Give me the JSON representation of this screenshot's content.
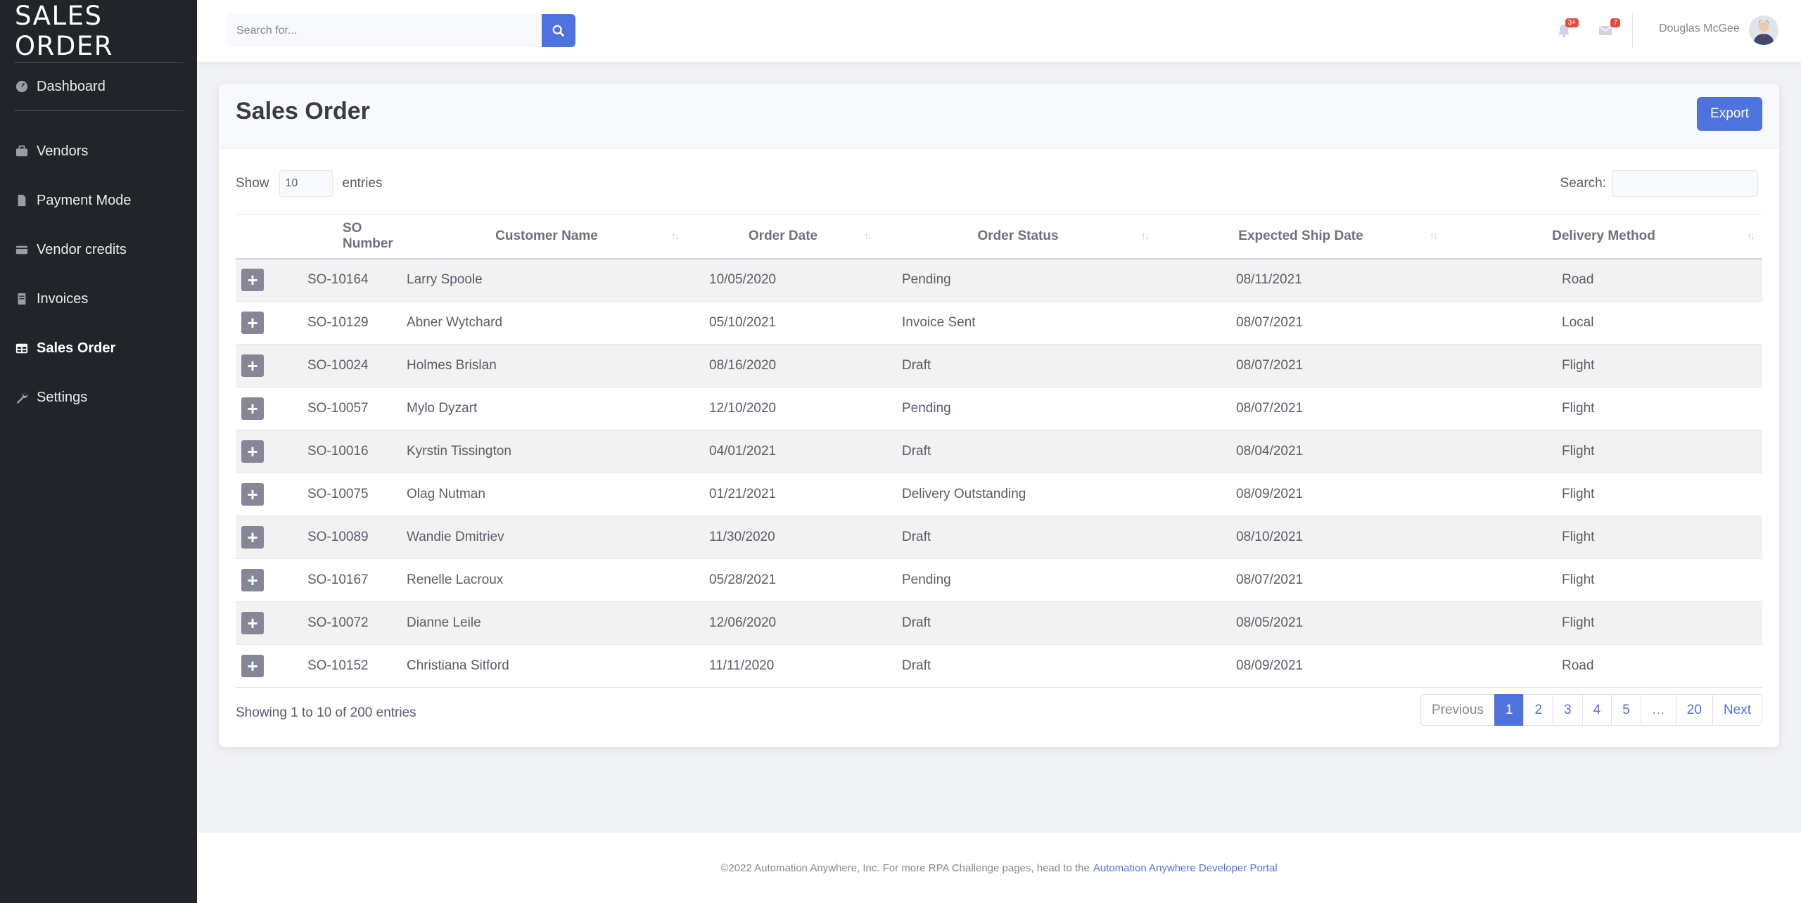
{
  "brand": "SALES ORDER",
  "sidebar": {
    "items": [
      {
        "label": "Dashboard",
        "icon": "gauge-icon"
      },
      {
        "label": "Vendors",
        "icon": "briefcase-icon"
      },
      {
        "label": "Payment Mode",
        "icon": "file-icon"
      },
      {
        "label": "Vendor credits",
        "icon": "credit-card-icon"
      },
      {
        "label": "Invoices",
        "icon": "invoice-icon"
      },
      {
        "label": "Sales Order",
        "icon": "table-icon",
        "active": true
      },
      {
        "label": "Settings",
        "icon": "wrench-icon"
      }
    ]
  },
  "topbar": {
    "search_placeholder": "Search for...",
    "alerts_badge": "3+",
    "messages_badge": "7",
    "user_name": "Douglas McGee"
  },
  "card": {
    "title": "Sales Order",
    "export_label": "Export",
    "show_label": "Show",
    "entries_value": "10",
    "entries_label": "entries",
    "search_label": "Search:"
  },
  "table": {
    "columns": [
      "SO Number",
      "Customer Name",
      "Order Date",
      "Order Status",
      "Expected Ship Date",
      "Delivery Method"
    ],
    "rows": [
      [
        "SO-10164",
        "Larry Spoole",
        "10/05/2020",
        "Pending",
        "08/11/2021",
        "Road"
      ],
      [
        "SO-10129",
        "Abner Wytchard",
        "05/10/2021",
        "Invoice Sent",
        "08/07/2021",
        "Local"
      ],
      [
        "SO-10024",
        "Holmes Brislan",
        "08/16/2020",
        "Draft",
        "08/07/2021",
        "Flight"
      ],
      [
        "SO-10057",
        "Mylo Dyzart",
        "12/10/2020",
        "Pending",
        "08/07/2021",
        "Flight"
      ],
      [
        "SO-10016",
        "Kyrstin Tissington",
        "04/01/2021",
        "Draft",
        "08/04/2021",
        "Flight"
      ],
      [
        "SO-10075",
        "Olag Nutman",
        "01/21/2021",
        "Delivery Outstanding",
        "08/09/2021",
        "Flight"
      ],
      [
        "SO-10089",
        "Wandie Dmitriev",
        "11/30/2020",
        "Draft",
        "08/10/2021",
        "Flight"
      ],
      [
        "SO-10167",
        "Renelle Lacroux",
        "05/28/2021",
        "Pending",
        "08/07/2021",
        "Flight"
      ],
      [
        "SO-10072",
        "Dianne Leile",
        "12/06/2020",
        "Draft",
        "08/05/2021",
        "Flight"
      ],
      [
        "SO-10152",
        "Christiana Sitford",
        "11/11/2020",
        "Draft",
        "08/09/2021",
        "Road"
      ]
    ],
    "info": "Showing 1 to 10 of 200 entries"
  },
  "pagination": {
    "previous": "Previous",
    "pages": [
      "1",
      "2",
      "3",
      "4",
      "5",
      "…",
      "20"
    ],
    "next": "Next",
    "active": "1"
  },
  "footer": {
    "text": "©2022 Automation Anywhere, Inc. For more RPA Challenge pages, head to the",
    "link": "Automation Anywhere Developer Portal"
  },
  "colors": {
    "sidebar_bg": "#212529",
    "accent": "#4e73df",
    "badge": "#e74a3b"
  }
}
